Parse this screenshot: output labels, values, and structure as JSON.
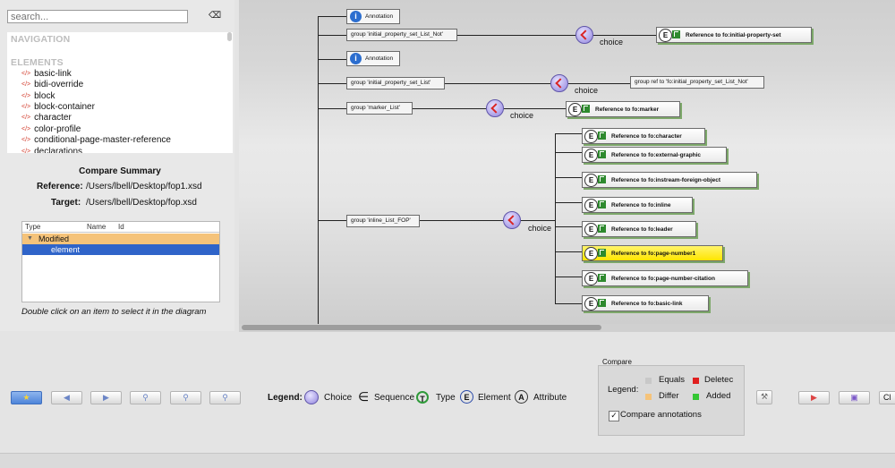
{
  "search": {
    "placeholder": "search..."
  },
  "navigation": {
    "heading": "NAVIGATION",
    "elements_heading": "ELEMENTS",
    "items": [
      "basic-link",
      "bidi-override",
      "block",
      "block-container",
      "character",
      "color-profile",
      "conditional-page-master-reference",
      "declarations"
    ]
  },
  "summary": {
    "title": "Compare Summary",
    "reference_label": "Reference:",
    "reference_value": "/Users/lbell/Desktop/fop1.xsd",
    "target_label": "Target:",
    "target_value": "/Users/lbell/Desktop/fop.xsd",
    "columns": [
      "Type",
      "Name",
      "Id"
    ],
    "rows": [
      {
        "type": "Modified",
        "expanded": true
      },
      {
        "type": "element"
      }
    ],
    "hint": "Double click on an item to select it in the diagram"
  },
  "diagram": {
    "annotations": [
      "Annotation",
      "Annotation"
    ],
    "groups": {
      "g1": "group 'initial_property_set_List_Not'",
      "g2": "group 'initial_property_set_List'",
      "g3": "group 'marker_List'",
      "g4": "group 'inline_List_FOP'"
    },
    "group_ref": "group ref to 'fo:initial_property_set_List_Not'",
    "choice_label": "choice",
    "references": [
      "Reference to fo:initial-property-set",
      "Reference to fo:marker",
      "Reference to fo:character",
      "Reference to fo:external-graphic",
      "Reference to fo:instream-foreign-object",
      "Reference to fo:inline",
      "Reference to fo:leader",
      "Reference to fo:page-number1",
      "Reference to fo:page-number-citation",
      "Reference to fo:basic-link"
    ],
    "highlighted_reference": "Reference to fo:page-number1"
  },
  "legend": {
    "title": "Legend:",
    "items": [
      "Choice",
      "Sequence",
      "Type",
      "Element",
      "Attribute"
    ]
  },
  "compare": {
    "title": "Compare",
    "legend_label": "Legend:",
    "equals": "Equals",
    "deleted": "Deletec",
    "differ": "Differ",
    "added": "Added",
    "annotations_label": "Compare annotations",
    "annotations_checked": true,
    "colors": {
      "equals": "#c8c8c8",
      "deleted": "#e01f1f",
      "differ": "#f5c37a",
      "added": "#35c735"
    }
  },
  "toolbar": {
    "cut_label": "Cl"
  }
}
